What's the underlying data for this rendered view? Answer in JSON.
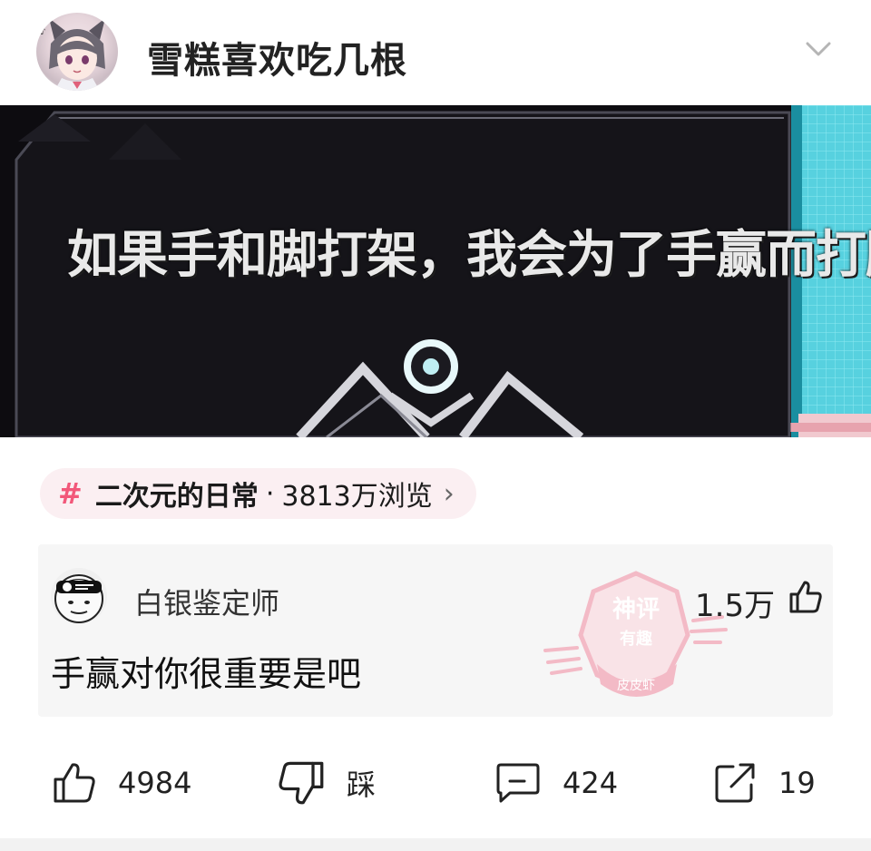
{
  "post": {
    "title": "雪糕喜欢吃几根",
    "image_caption": "如果手和脚打架，我会为了手赢而打脚"
  },
  "topic": {
    "hash": "#",
    "name": "二次元的日常",
    "separator": "·",
    "views": "3813万浏览",
    "arrow": "›"
  },
  "comment": {
    "username": "白银鉴定师",
    "text": "手赢对你很重要是吧",
    "likes": "1.5万",
    "badge": {
      "line1": "神评",
      "line2": "有趣",
      "line3": "皮皮虾"
    }
  },
  "actions": {
    "like_count": "4984",
    "dislike_label": "踩",
    "comment_count": "424",
    "share_count": "19"
  },
  "colors": {
    "accent_pink": "#f2587a",
    "topic_bg": "#fbeff2",
    "comment_bg": "#f6f6f6",
    "badge_pink": "#f3a7b7"
  }
}
